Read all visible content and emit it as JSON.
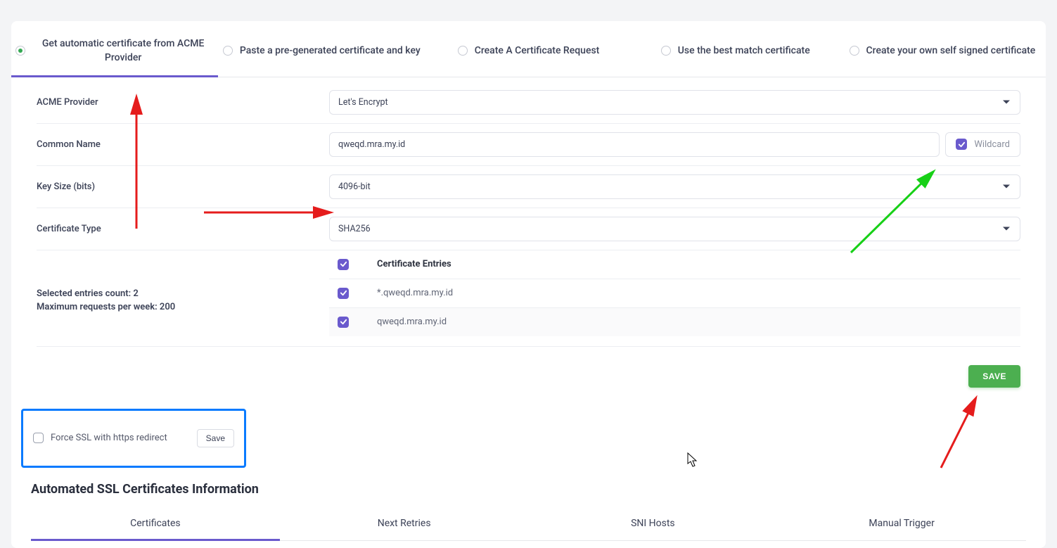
{
  "topTabs": [
    {
      "label": "Get automatic certificate from ACME Provider",
      "active": true
    },
    {
      "label": "Paste a pre-generated certificate and key",
      "active": false
    },
    {
      "label": "Create A Certificate Request",
      "active": false
    },
    {
      "label": "Use the best match certificate",
      "active": false
    },
    {
      "label": "Create your own self signed certificate",
      "active": false
    }
  ],
  "fields": {
    "acmeProvider": {
      "label": "ACME Provider",
      "value": "Let's Encrypt"
    },
    "commonName": {
      "label": "Common Name",
      "value": "qweqd.mra.my.id",
      "wildcardLabel": "Wildcard",
      "wildcardChecked": true
    },
    "keySize": {
      "label": "Key Size (bits)",
      "value": "4096-bit"
    },
    "certType": {
      "label": "Certificate Type",
      "value": "SHA256"
    }
  },
  "entries": {
    "summary1": "Selected entries count: 2",
    "summary2": "Maximum requests per week: 200",
    "headerLabel": "Certificate Entries",
    "items": [
      {
        "label": "*.qweqd.mra.my.id",
        "checked": true
      },
      {
        "label": "qweqd.mra.my.id",
        "checked": true
      }
    ]
  },
  "saveButton": "SAVE",
  "forceSsl": {
    "label": "Force SSL with https redirect",
    "save": "Save",
    "checked": false
  },
  "sectionTitle": "Automated SSL Certificates Information",
  "bottomTabs": [
    {
      "label": "Certificates",
      "active": true
    },
    {
      "label": "Next Retries",
      "active": false
    },
    {
      "label": "SNI Hosts",
      "active": false
    },
    {
      "label": "Manual Trigger",
      "active": false
    }
  ]
}
